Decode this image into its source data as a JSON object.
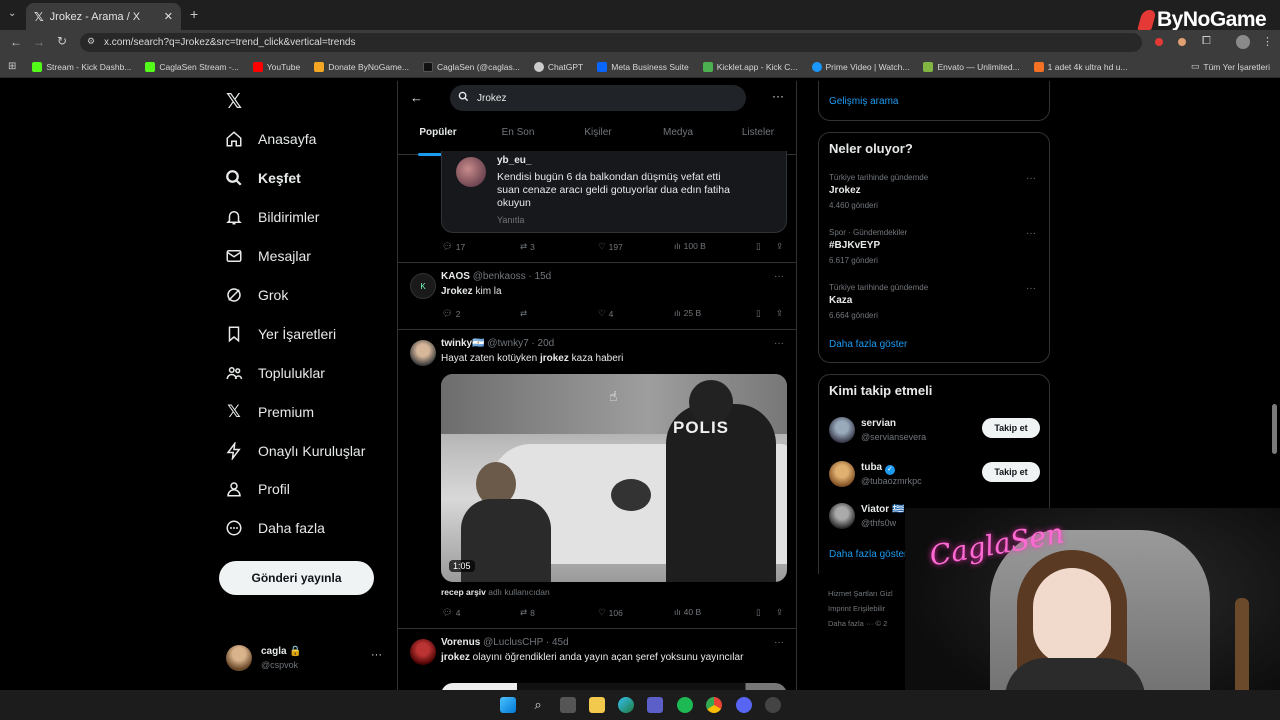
{
  "browser": {
    "tab_title": "Jrokez - Arama / X",
    "url": "x.com/search?q=Jrokez&src=trend_click&vertical=trends",
    "bookmarks": [
      {
        "label": "Stream - Kick Dashb...",
        "color": "#53fc18"
      },
      {
        "label": "CaglaSen Stream -...",
        "color": "#53fc18"
      },
      {
        "label": "YouTube",
        "color": "#ff0000"
      },
      {
        "label": "Donate ByNoGame...",
        "color": "#f5a623"
      },
      {
        "label": "CaglaSen (@caglas...",
        "color": "#111111"
      },
      {
        "label": "ChatGPT",
        "color": "#cccccc"
      },
      {
        "label": "Meta Business Suite",
        "color": "#0866ff"
      },
      {
        "label": "Kicklet.app - Kick C...",
        "color": "#4caf50"
      },
      {
        "label": "Prime Video | Watch...",
        "color": "#1a98ff"
      },
      {
        "label": "Envato — Unlimited...",
        "color": "#82b541"
      },
      {
        "label": "1 adet 4k ultra hd u...",
        "color": "#f57224"
      }
    ],
    "all_bookmarks": "Tüm Yer İşaretleri"
  },
  "watermark": "ByNoGame",
  "nav": {
    "items": [
      {
        "label": "Anasayfa",
        "icon": "home-icon"
      },
      {
        "label": "Keşfet",
        "icon": "search-icon"
      },
      {
        "label": "Bildirimler",
        "icon": "bell-icon"
      },
      {
        "label": "Mesajlar",
        "icon": "mail-icon"
      },
      {
        "label": "Grok",
        "icon": "grok-icon"
      },
      {
        "label": "Yer İşaretleri",
        "icon": "bookmark-icon"
      },
      {
        "label": "Topluluklar",
        "icon": "communities-icon"
      },
      {
        "label": "Premium",
        "icon": "x-logo-icon"
      },
      {
        "label": "Onaylı Kuruluşlar",
        "icon": "bolt-icon"
      },
      {
        "label": "Profil",
        "icon": "person-icon"
      },
      {
        "label": "Daha fazla",
        "icon": "more-circle-icon"
      }
    ],
    "post_button": "Gönderi yayınla",
    "account": {
      "name": "cagla",
      "handle": "@cspvok"
    }
  },
  "search": {
    "query": "Jrokez",
    "tabs": [
      "Popüler",
      "En Son",
      "Kişiler",
      "Medya",
      "Listeler"
    ]
  },
  "tweets": [
    {
      "quoted_user": "yb_eu_",
      "quoted_text": [
        "Kendisi bugün 6 da balkondan düşmüş vefat etti",
        "suan cenaze aracı geldi gotuyorlar dua edın fatiha",
        "okuyun"
      ],
      "quoted_reply": "Yanıtla",
      "replies": "17",
      "reposts": "3",
      "likes": "197",
      "views": "100 B"
    },
    {
      "name": "KAOS",
      "handle": "@benkaoss",
      "time": "15d",
      "text_bold": "Jrokez",
      "text": " kim la",
      "replies": "2",
      "reposts": "",
      "likes": "4",
      "views": "25 B"
    },
    {
      "name": "twinky🇦🇷",
      "handle": "@twnky7",
      "time": "20d",
      "text_pre": "Hayat zaten kotüyken ",
      "text_bold": "jrokez",
      "text_post": " kaza haberi",
      "video_duration": "1:05",
      "media_label": "POLIS",
      "credit_user": "recep arşiv",
      "credit_suffix": " adlı kullanıcıdan",
      "replies": "4",
      "reposts": "8",
      "likes": "106",
      "views": "40 B"
    },
    {
      "name": "Vorenus",
      "handle": "@LuclusCHP",
      "time": "45d",
      "text_bold": "jrokez",
      "text": " olayını öğrendikleri anda yayın açan şeref yoksunu yayıncılar"
    }
  ],
  "right": {
    "advanced_search": "Gelişmiş arama",
    "trends_title": "Neler oluyor?",
    "trends": [
      {
        "context": "Türkiye tarihinde gündemde",
        "name": "Jrokez",
        "count": "4.460 gönderi"
      },
      {
        "context": "Spor · Gündemdekiler",
        "name": "#BJKvEYP",
        "count": "6.617 gönderi"
      },
      {
        "context": "Türkiye tarihinde gündemde",
        "name": "Kaza",
        "count": "6.664 gönderi"
      }
    ],
    "show_more": "Daha fazla göster",
    "who_to_follow_title": "Kimi takip etmeli",
    "suggestions": [
      {
        "name": "servian",
        "handle": "@serviansevera",
        "button": "Takip et"
      },
      {
        "name": "tuba",
        "handle": "@tubaozmrkpc",
        "button": "Takip et"
      },
      {
        "name": "Viator 🇬🇷",
        "handle": "@thfs0w",
        "button": ""
      }
    ],
    "show_more_2": "Daha fazla göster",
    "footer": [
      "Hizmet Şartları",
      "Gizl",
      "Imprint",
      "Erişilebilir",
      "Daha fazla ···",
      "© 2"
    ]
  },
  "webcam_sign": "CaglaSen"
}
